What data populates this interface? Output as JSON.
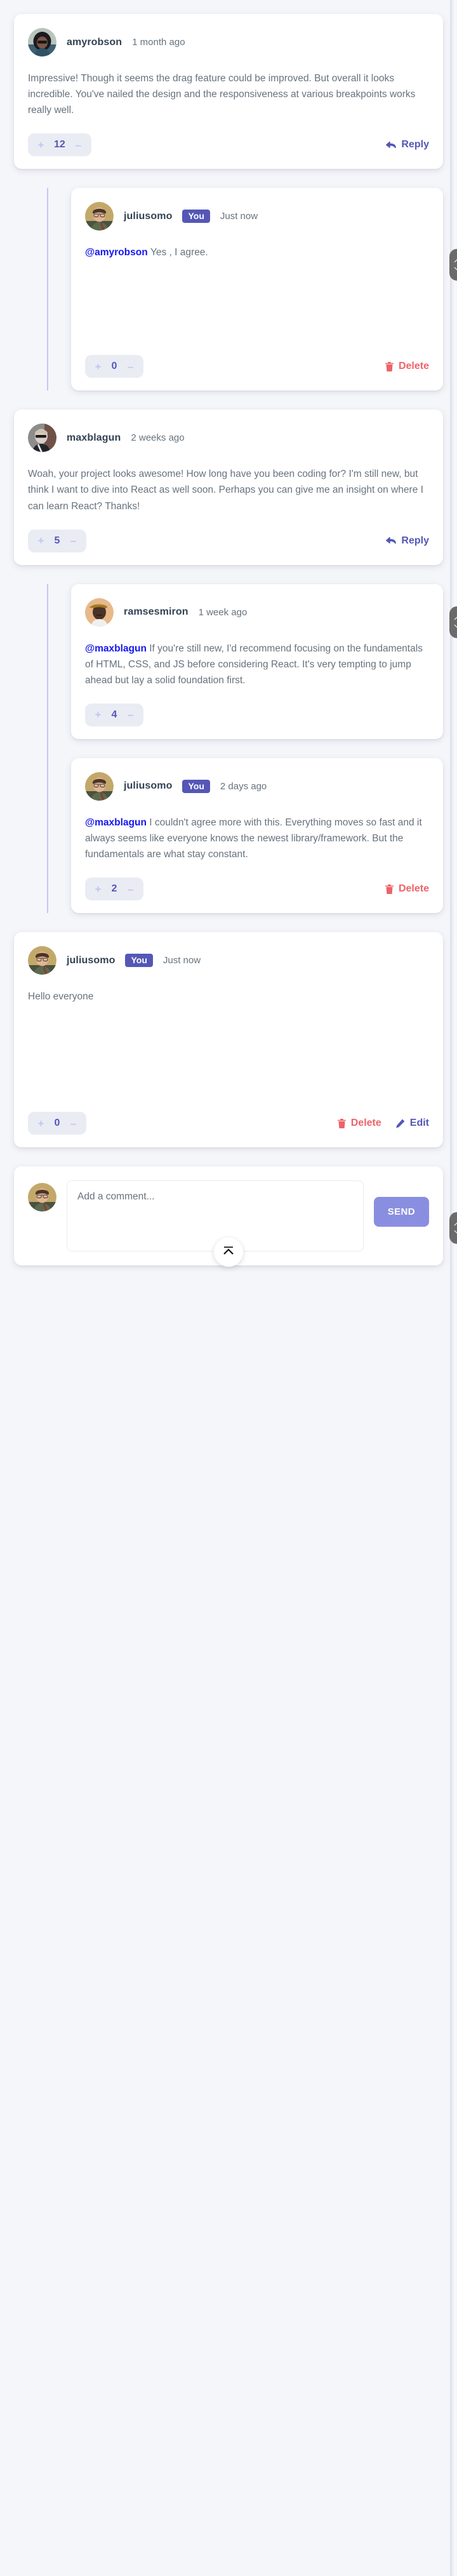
{
  "accent": {
    "moderate_blue": "#5457b6",
    "light_grayish_blue": "#eaecf4",
    "soft_red": "#ed6368",
    "light_purple": "#8a8ee0",
    "mention_blue": "#1616ef",
    "dark_blue": "#334253",
    "grayish_blue": "#67727e",
    "page_bg": "#f5f6fa"
  },
  "labels": {
    "reply": "Reply",
    "delete": "Delete",
    "edit": "Edit",
    "send": "SEND",
    "you": "You",
    "plus": "+",
    "minus": "–"
  },
  "icons": {
    "reply": "reply-arrow-icon",
    "delete": "trash-icon",
    "edit": "pencil-icon",
    "scroll_top": "chevron-up-icon",
    "scroll_pill_up": "chevron-up-icon",
    "scroll_pill_down": "chevron-down-icon"
  },
  "comments": [
    {
      "id": "c1",
      "user": "amyrobson",
      "is_you": false,
      "timestamp": "1 month ago",
      "score": "12",
      "mention": "",
      "body": "Impressive! Though it seems the drag feature could be improved. But overall it looks incredible. You've nailed the design and the responsiveness at various breakpoints works really well.",
      "action": "reply"
    },
    {
      "id": "c1r1",
      "user": "juliusomo",
      "is_you": true,
      "timestamp": "Just now",
      "score": "0",
      "mention": "@amyrobson",
      "body": "Yes , I agree.",
      "action": "delete"
    },
    {
      "id": "c2",
      "user": "maxblagun",
      "is_you": false,
      "timestamp": "2 weeks ago",
      "score": "5",
      "mention": "",
      "body": "Woah, your project looks awesome! How long have you been coding for? I'm still new, but think I want to dive into React as well soon. Perhaps you can give me an insight on where I can learn React? Thanks!",
      "action": "reply"
    },
    {
      "id": "c2r1",
      "user": "ramsesmiron",
      "is_you": false,
      "timestamp": "1 week ago",
      "score": "4",
      "mention": "@maxblagun",
      "body": "If you're still new, I'd recommend focusing on the fundamentals of HTML, CSS, and JS before considering React. It's very tempting to jump ahead but lay a solid foundation first.",
      "action": "none"
    },
    {
      "id": "c2r2",
      "user": "juliusomo",
      "is_you": true,
      "timestamp": "2 days ago",
      "score": "2",
      "mention": "@maxblagun",
      "body": "I couldn't agree more with this. Everything moves so fast and it always seems like everyone knows the newest library/framework. But the fundamentals are what stay constant.",
      "action": "delete"
    },
    {
      "id": "c3",
      "user": "juliusomo",
      "is_you": true,
      "timestamp": "Just now",
      "score": "0",
      "mention": "",
      "body": "Hello everyone",
      "action": "delete_edit"
    }
  ],
  "form": {
    "value": "",
    "placeholder": "Add a comment...",
    "send_label": "SEND",
    "avatar_user": "juliusomo"
  }
}
